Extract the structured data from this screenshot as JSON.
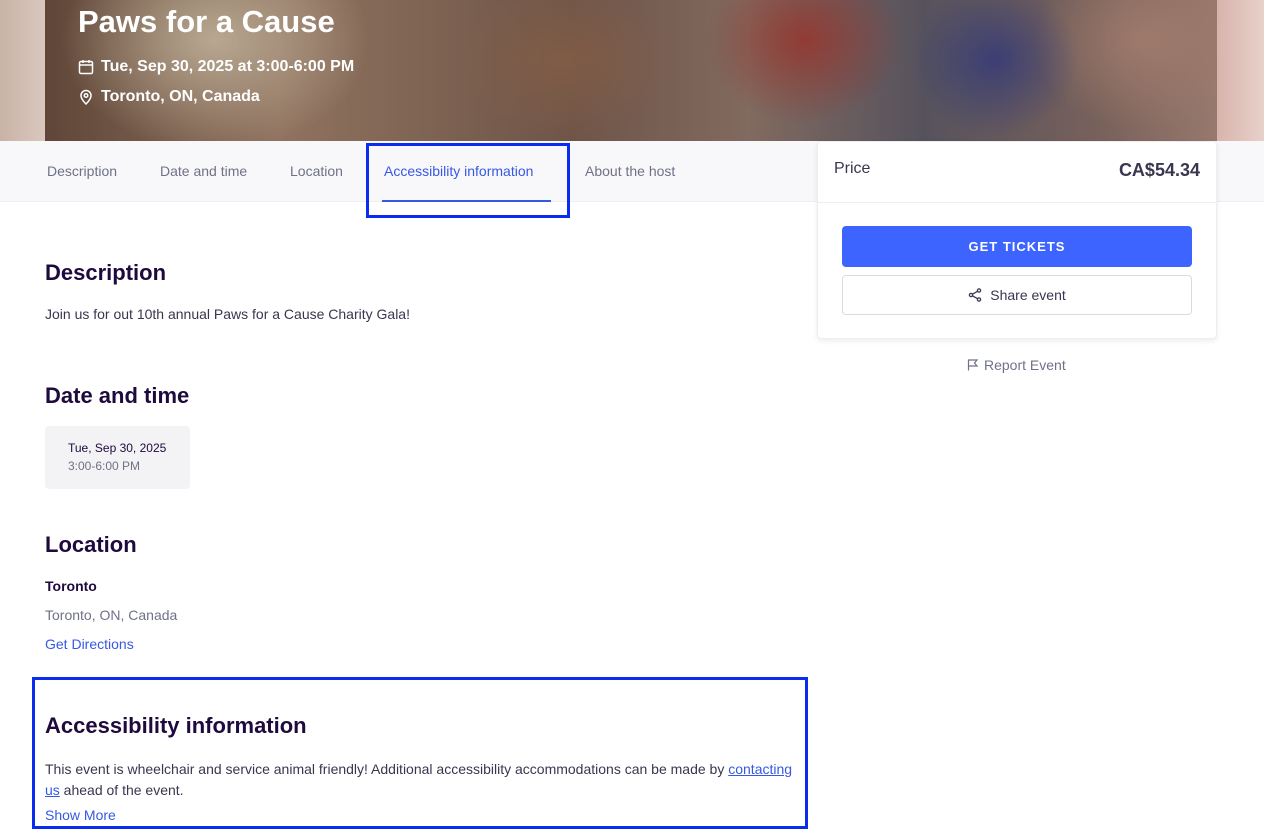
{
  "hero": {
    "title": "Paws for a Cause",
    "date_line": "Tue, Sep 30, 2025 at 3:00-6:00 PM",
    "location_line": "Toronto, ON, Canada"
  },
  "tabs": [
    {
      "label": "Description"
    },
    {
      "label": "Date and time"
    },
    {
      "label": "Location"
    },
    {
      "label": "Accessibility information",
      "active": true
    },
    {
      "label": "About the host"
    }
  ],
  "ticket_card": {
    "price_label": "Price",
    "price_value": "CA$54.34",
    "get_tickets_label": "GET TICKETS",
    "share_label": "Share event"
  },
  "report_label": "Report Event",
  "description": {
    "title": "Description",
    "text": "Join us for out 10th annual Paws for a Cause Charity Gala!"
  },
  "date_time": {
    "title": "Date and time",
    "date": "Tue, Sep 30, 2025",
    "time": "3:00-6:00 PM"
  },
  "location": {
    "title": "Location",
    "name": "Toronto",
    "address": "Toronto, ON, Canada",
    "directions_label": "Get Directions"
  },
  "accessibility": {
    "title": "Accessibility information",
    "text_before": "This event is wheelchair and service animal friendly! Additional accessibility accommodations can be made by ",
    "link_label": "contacting us",
    "text_after": " ahead of the event.",
    "show_more_label": "Show More"
  },
  "colors": {
    "accent": "#3659e3",
    "primary_button": "#3d64ff",
    "highlight_box": "#0a2cf0"
  }
}
